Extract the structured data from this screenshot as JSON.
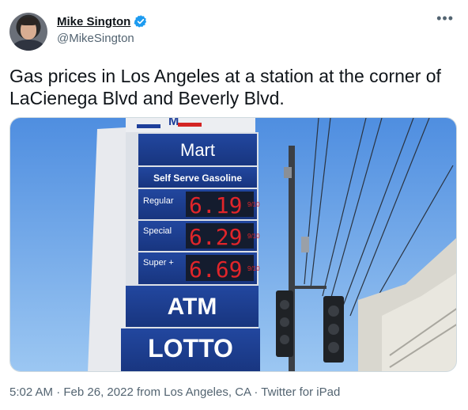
{
  "author": {
    "display_name": "Mike Sington",
    "handle": "@MikeSington",
    "verified_icon": "verified-badge-icon"
  },
  "more_icon": "more-options-icon",
  "tweet": {
    "text_line1": "Gas prices in Los Angeles at a station at the corner of",
    "text_line2": "LaCienega Blvd and Beverly Blvd."
  },
  "photo": {
    "sign_brand": "Mart",
    "sign_subtitle": "Self Serve Gasoline",
    "grades": [
      {
        "label": "Regular",
        "price": "6.19",
        "fraction": "9/10"
      },
      {
        "label": "Special",
        "price": "6.29",
        "fraction": "9/10"
      },
      {
        "label": "Super +",
        "price": "6.69",
        "fraction": "9/10"
      }
    ],
    "atm_label": "ATM",
    "lotto_label": "LOTTO",
    "top_partial": "M"
  },
  "meta": {
    "time": "5:02 AM",
    "sep1": " · ",
    "date": "Feb 26, 2022 from Los Angeles, CA",
    "sep2": " · ",
    "client": "Twitter for iPad"
  },
  "colors": {
    "accent": "#1d9bf0",
    "text_primary": "#0f1419",
    "text_secondary": "#536471",
    "sign_blue": "#1e3f9a",
    "price_red": "#e0252a"
  }
}
